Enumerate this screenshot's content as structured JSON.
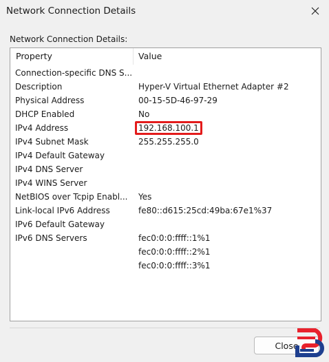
{
  "window": {
    "title": "Network Connection Details"
  },
  "section_label": "Network Connection Details:",
  "columns": {
    "property": "Property",
    "value": "Value"
  },
  "rows": [
    {
      "property": "Connection-specific DNS S...",
      "value": ""
    },
    {
      "property": "Description",
      "value": "Hyper-V Virtual Ethernet Adapter #2"
    },
    {
      "property": "Physical Address",
      "value": "00-15-5D-46-97-29"
    },
    {
      "property": "DHCP Enabled",
      "value": "No"
    },
    {
      "property": "IPv4 Address",
      "value": "192.168.100.1"
    },
    {
      "property": "IPv4 Subnet Mask",
      "value": "255.255.255.0"
    },
    {
      "property": "IPv4 Default Gateway",
      "value": ""
    },
    {
      "property": "IPv4 DNS Server",
      "value": ""
    },
    {
      "property": "IPv4 WINS Server",
      "value": ""
    },
    {
      "property": "NetBIOS over Tcpip Enabl...",
      "value": "Yes"
    },
    {
      "property": "Link-local IPv6 Address",
      "value": "fe80::d615:25cd:49ba:67e1%37"
    },
    {
      "property": "IPv6 Default Gateway",
      "value": ""
    },
    {
      "property": "IPv6 DNS Servers",
      "value": "fec0:0:0:ffff::1%1"
    },
    {
      "property": "",
      "value": "fec0:0:0:ffff::2%1"
    },
    {
      "property": "",
      "value": "fec0:0:0:ffff::3%1"
    }
  ],
  "buttons": {
    "close": "Close"
  },
  "colors": {
    "highlight_border": "#e31b1b",
    "logo_red": "#e8212c",
    "logo_blue": "#1e3f8f"
  },
  "icons": {
    "close": "close-icon",
    "logo": "logo-icon"
  }
}
